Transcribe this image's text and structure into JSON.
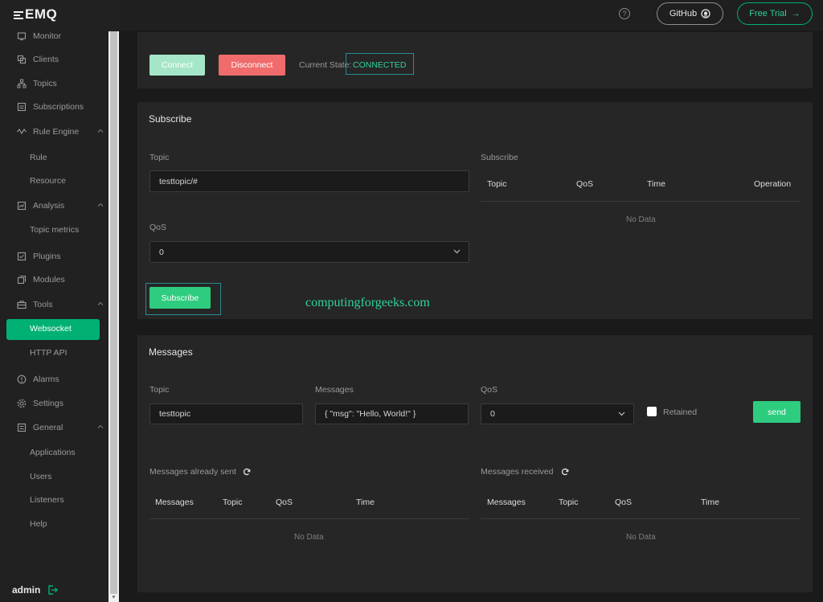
{
  "app": {
    "brand": "EMQ",
    "user": "admin"
  },
  "header": {
    "github_label": "GitHub",
    "trial_label": "Free Trial"
  },
  "sidebar": {
    "items": [
      {
        "label": "Monitor",
        "icon": "monitor-icon"
      },
      {
        "label": "Clients",
        "icon": "clients-icon"
      },
      {
        "label": "Topics",
        "icon": "topics-icon"
      },
      {
        "label": "Subscriptions",
        "icon": "subscriptions-icon"
      },
      {
        "label": "Rule Engine",
        "icon": "rule-engine-icon"
      },
      {
        "label": "Rule"
      },
      {
        "label": "Resource"
      },
      {
        "label": "Analysis",
        "icon": "analysis-icon"
      },
      {
        "label": "Topic metrics"
      },
      {
        "label": "Plugins",
        "icon": "plugins-icon"
      },
      {
        "label": "Modules",
        "icon": "modules-icon"
      },
      {
        "label": "Tools",
        "icon": "tools-icon"
      },
      {
        "label": "Websocket",
        "active": true
      },
      {
        "label": "HTTP API"
      },
      {
        "label": "Alarms",
        "icon": "alarms-icon"
      },
      {
        "label": "Settings",
        "icon": "settings-icon"
      },
      {
        "label": "General",
        "icon": "general-icon"
      },
      {
        "label": "Applications"
      },
      {
        "label": "Users"
      },
      {
        "label": "Listeners"
      },
      {
        "label": "Help"
      }
    ]
  },
  "connection": {
    "connect_label": "Connect",
    "disconnect_label": "Disconnect",
    "state_label": "Current State:",
    "state_value": "CONNECTED"
  },
  "subscribe": {
    "title": "Subscribe",
    "topic_label": "Topic",
    "topic_value": "testtopic/#",
    "qos_label": "QoS",
    "qos_value": "0",
    "button_label": "Subscribe",
    "list_title": "Subscribe",
    "columns": [
      "Topic",
      "QoS",
      "Time",
      "Operation"
    ],
    "empty": "No Data"
  },
  "watermark": "computingforgeeks.com",
  "messages": {
    "title": "Messages",
    "topic_label": "Topic",
    "topic_value": "testtopic",
    "message_label": "Messages",
    "message_value": "{ \"msg\": \"Hello, World!\" }",
    "qos_label": "QoS",
    "qos_value": "0",
    "retained_label": "Retained",
    "send_label": "send",
    "sent": {
      "title": "Messages already sent",
      "columns": [
        "Messages",
        "Topic",
        "QoS",
        "Time"
      ],
      "empty": "No Data"
    },
    "received": {
      "title": "Messages received",
      "columns": [
        "Messages",
        "Topic",
        "QoS",
        "Time"
      ],
      "empty": "No Data"
    }
  },
  "colors": {
    "accent": "#00b173",
    "connect_bg": "#a6e6c8",
    "disconnect_bg": "#f06b6b",
    "panel_bg": "#262626",
    "page_bg": "#1a1a1a"
  }
}
